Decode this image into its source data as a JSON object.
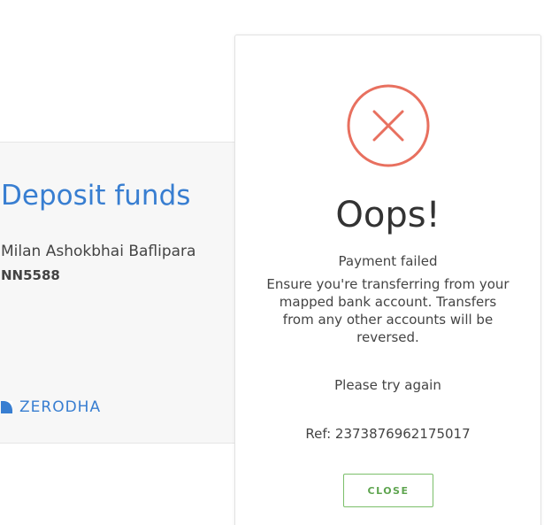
{
  "deposit": {
    "title": "Deposit funds",
    "account_name": "Milan Ashokbhai Baflipara",
    "account_id": "NN5588",
    "brand": "ZERODHA"
  },
  "modal": {
    "icon": "close-circle-icon",
    "heading": "Oops!",
    "status": "Payment failed",
    "message": "Ensure you're transferring from your mapped bank account. Transfers from any other accounts will be reversed.",
    "retry": "Please try again",
    "ref": "Ref: 2373876962175017",
    "close_label": "CLOSE"
  },
  "colors": {
    "brand_blue": "#387ed1",
    "error_red": "#e8705f",
    "success_green": "#5fa550"
  }
}
